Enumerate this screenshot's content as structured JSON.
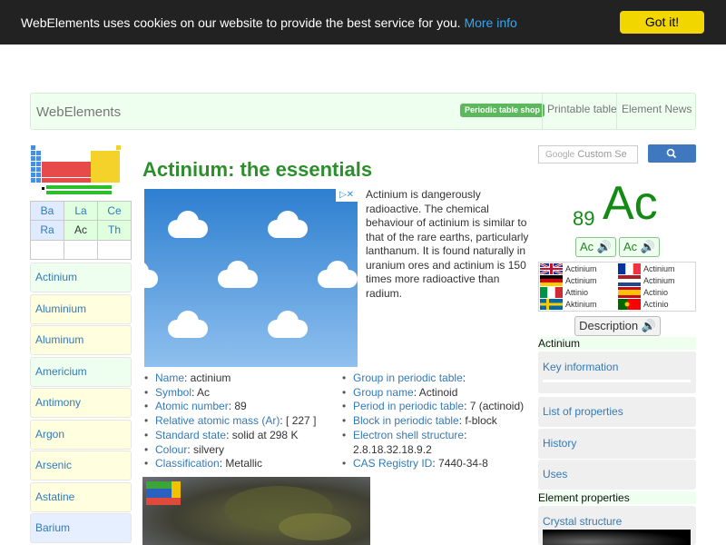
{
  "cookie": {
    "message": "WebElements uses cookies on our website to provide the best service for you.",
    "more_info": "More info",
    "button": "Got it!"
  },
  "nav": {
    "brand": "WebElements",
    "shop": "Periodic table shop",
    "links": [
      "Printable table",
      "Element News"
    ]
  },
  "element_grid": {
    "row1": [
      "Ba",
      "La",
      "Ce"
    ],
    "row2": [
      "Ra",
      "Ac",
      "Th"
    ]
  },
  "sidebar": {
    "items": [
      {
        "label": "Actinium",
        "tint": "green"
      },
      {
        "label": "Aluminium",
        "tint": "yellow"
      },
      {
        "label": "Aluminum",
        "tint": "yellow"
      },
      {
        "label": "Americium",
        "tint": "green"
      },
      {
        "label": "Antimony",
        "tint": "yellow"
      },
      {
        "label": "Argon",
        "tint": "yellow"
      },
      {
        "label": "Arsenic",
        "tint": "yellow"
      },
      {
        "label": "Astatine",
        "tint": "yellow"
      },
      {
        "label": "Barium",
        "tint": "blue"
      }
    ]
  },
  "main": {
    "title": "Actinium: the essentials",
    "intro": "Actinium is dangerously radioactive. The chemical behaviour of actinium is similar to that of the rare earths, particularly lanthanum. It is found naturally in uranium ores and actinium is 150 times more radioactive than radium.",
    "facts_left": [
      {
        "label": "Name",
        "value": ": actinium"
      },
      {
        "label": "Symbol",
        "value": ": Ac"
      },
      {
        "label": "Atomic number",
        "value": ": 89"
      },
      {
        "label": "Relative atomic mass (Ar)",
        "value": ": [ 227 ]"
      },
      {
        "label": "Standard state",
        "value": ": solid at 298 K"
      },
      {
        "label": "Colour",
        "value": ": silvery"
      },
      {
        "label": "Classification",
        "value": ": Metallic"
      }
    ],
    "facts_right": [
      {
        "label": "Group in periodic table",
        "value": ":"
      },
      {
        "label": "Group name",
        "value": ": Actinoid"
      },
      {
        "label": "Period in periodic table",
        "value": ": 7 (actinoid)"
      },
      {
        "label": "Block in periodic table",
        "value": ": f-block"
      },
      {
        "label": "Electron shell structure",
        "value": ":"
      },
      {
        "label": "electron_shell_value",
        "value": "2.8.18.32.18.9.2"
      },
      {
        "label": "CAS Registry ID",
        "value": ": 7440-34-8"
      }
    ]
  },
  "right": {
    "search_placeholder": "Custom Se",
    "search_brand": "Google",
    "atomic_number": "89",
    "symbol": "Ac",
    "speak_buttons": [
      "Ac",
      "Ac"
    ],
    "languages": [
      {
        "name": "Actinium",
        "flag": "uk"
      },
      {
        "name": "Actinium",
        "flag": "fr"
      },
      {
        "name": "Actinium",
        "flag": "de"
      },
      {
        "name": "Actinium",
        "flag": "nl"
      },
      {
        "name": "Attinio",
        "flag": "it"
      },
      {
        "name": "Actinio",
        "flag": "es"
      },
      {
        "name": "Aktinium",
        "flag": "se"
      },
      {
        "name": "Actínio",
        "flag": "pt"
      }
    ],
    "description_button": "Description",
    "section1": "Actinium",
    "key_info": "Key information",
    "list_props": "List of properties",
    "history": "History",
    "uses": "Uses",
    "section2": "Element properties",
    "crystal": "Crystal structure"
  },
  "colors": {
    "accent_green": "#2c8f2c",
    "link": "#337ab7",
    "cookie_button": "#f1d600"
  }
}
